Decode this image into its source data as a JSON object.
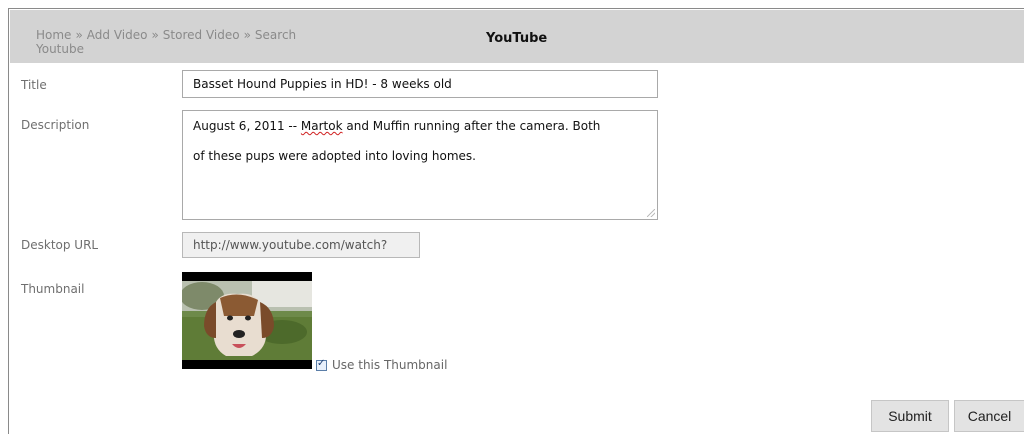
{
  "header": {
    "breadcrumb": [
      "Home",
      "Add Video",
      "Stored Video",
      "Search Youtube"
    ],
    "breadcrumb_separator": "»",
    "title": "YouTube"
  },
  "form": {
    "title_label": "Title",
    "title_value": "Basset Hound Puppies in HD! - 8 weeks old",
    "description_label": "Description",
    "description_line1_pre": "August 6, 2011 -- ",
    "description_line1_word": "Martok",
    "description_line1_post": " and Muffin running after the camera. Both",
    "description_line2": "of these pups were adopted into loving homes.",
    "desktop_url_label": "Desktop URL",
    "desktop_url_value": "http://www.youtube.com/watch?",
    "thumbnail_label": "Thumbnail",
    "use_thumbnail_label": "Use this Thumbnail",
    "use_thumbnail_checked": true
  },
  "buttons": {
    "submit": "Submit",
    "cancel": "Cancel"
  },
  "colors": {
    "header_bg": "#d3d3d3",
    "label": "#6f6f6f",
    "button_bg": "#e3e3e3"
  }
}
